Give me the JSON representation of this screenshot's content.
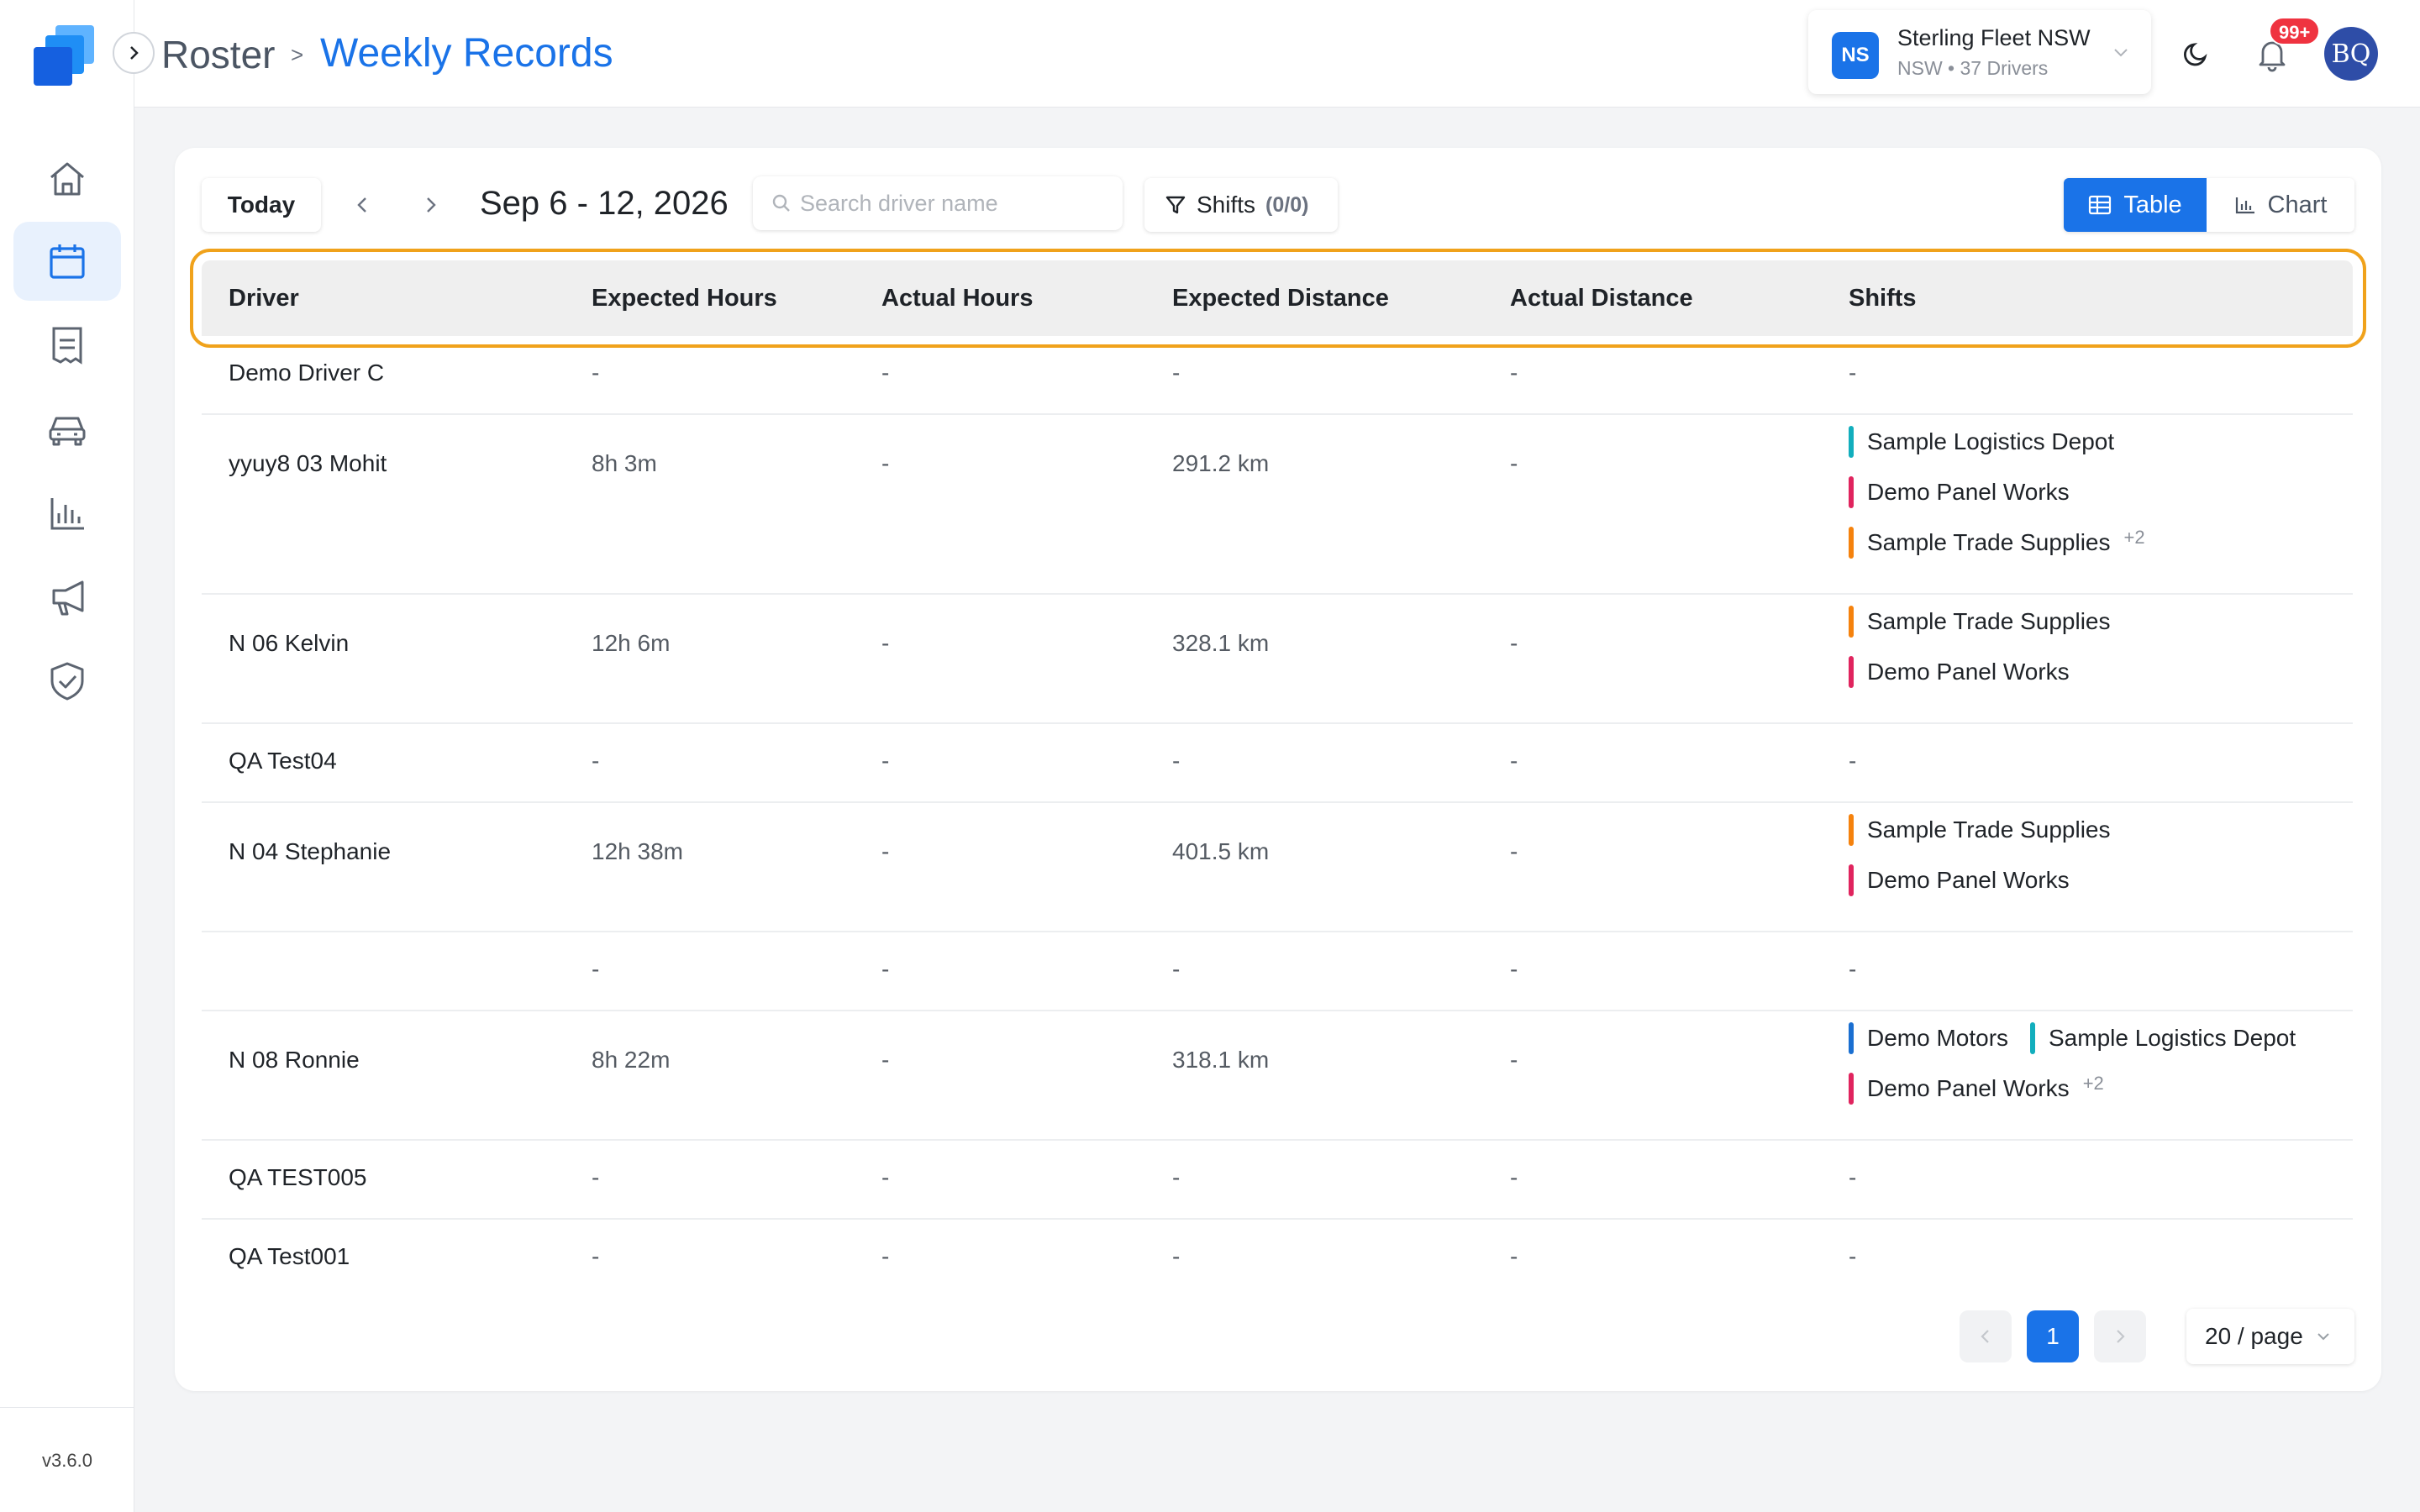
{
  "app": {
    "version": "v3.6.0",
    "brand_color": "#1a73e8"
  },
  "sidebar": {
    "items": [
      {
        "name": "home",
        "icon": "home-icon"
      },
      {
        "name": "roster",
        "icon": "calendar-icon",
        "active": true
      },
      {
        "name": "records",
        "icon": "document-list-icon"
      },
      {
        "name": "vehicles",
        "icon": "car-icon"
      },
      {
        "name": "reports",
        "icon": "bar-chart-icon"
      },
      {
        "name": "announcements",
        "icon": "megaphone-icon"
      },
      {
        "name": "compliance",
        "icon": "shield-check-icon"
      }
    ]
  },
  "header": {
    "breadcrumb_root": "Roster",
    "breadcrumb_sep": ">",
    "breadcrumb_current": "Weekly Records",
    "org": {
      "initials": "NS",
      "name": "Sterling Fleet NSW",
      "sub": "NSW • 37 Drivers"
    },
    "notifications_badge": "99+",
    "avatar_initials": "BQ"
  },
  "toolbar": {
    "today_label": "Today",
    "date_range": "Sep 6 - 12, 2026",
    "search_placeholder": "Search driver name",
    "shifts_label": "Shifts",
    "shifts_count": "(0/0)",
    "view_table_label": "Table",
    "view_chart_label": "Chart",
    "active_view": "Table"
  },
  "table": {
    "columns": [
      "Driver",
      "Expected Hours",
      "Actual Hours",
      "Expected Distance",
      "Actual Distance",
      "Shifts"
    ],
    "rows": [
      {
        "driver": "Demo Driver C",
        "expected_hours": "-",
        "actual_hours": "-",
        "expected_distance": "-",
        "actual_distance": "-",
        "shifts": "-"
      },
      {
        "driver": "yyuy8 03 Mohit",
        "expected_hours": "8h 3m",
        "actual_hours": "-",
        "expected_distance": "291.2 km",
        "actual_distance": "-",
        "shift_tags": [
          {
            "label": "Sample Logistics Depot",
            "color": "#12aebd"
          },
          {
            "label": "Demo Panel Works",
            "color": "#e0245e"
          },
          {
            "label": "Sample Trade Supplies",
            "color": "#f5820d",
            "more": "+2"
          }
        ]
      },
      {
        "driver": "N 06 Kelvin",
        "expected_hours": "12h 6m",
        "actual_hours": "-",
        "expected_distance": "328.1 km",
        "actual_distance": "-",
        "shift_tags": [
          {
            "label": "Sample Trade Supplies",
            "color": "#f5820d"
          },
          {
            "label": "Demo Panel Works",
            "color": "#e0245e"
          }
        ]
      },
      {
        "driver": "QA Test04",
        "expected_hours": "-",
        "actual_hours": "-",
        "expected_distance": "-",
        "actual_distance": "-",
        "shifts": "-"
      },
      {
        "driver": "N 04 Stephanie",
        "expected_hours": "12h 38m",
        "actual_hours": "-",
        "expected_distance": "401.5 km",
        "actual_distance": "-",
        "shift_tags": [
          {
            "label": "Sample Trade Supplies",
            "color": "#f5820d"
          },
          {
            "label": "Demo Panel Works",
            "color": "#e0245e"
          }
        ]
      },
      {
        "driver": "",
        "expected_hours": "-",
        "actual_hours": "-",
        "expected_distance": "-",
        "actual_distance": "-",
        "shifts": "-"
      },
      {
        "driver": "N 08 Ronnie",
        "expected_hours": "8h 22m",
        "actual_hours": "-",
        "expected_distance": "318.1 km",
        "actual_distance": "-",
        "shift_tags": [
          {
            "label": "Demo Motors",
            "color": "#1a6fd1"
          },
          {
            "label": "Sample Logistics Depot",
            "color": "#12aebd"
          },
          {
            "label": "Demo Panel Works",
            "color": "#e0245e",
            "more": "+2"
          }
        ]
      },
      {
        "driver": "QA TEST005",
        "expected_hours": "-",
        "actual_hours": "-",
        "expected_distance": "-",
        "actual_distance": "-",
        "shifts": "-"
      },
      {
        "driver": "QA Test001",
        "expected_hours": "-",
        "actual_hours": "-",
        "expected_distance": "-",
        "actual_distance": "-",
        "shifts": "-"
      }
    ]
  },
  "pagination": {
    "current_page": "1",
    "page_size": "20 / page"
  }
}
